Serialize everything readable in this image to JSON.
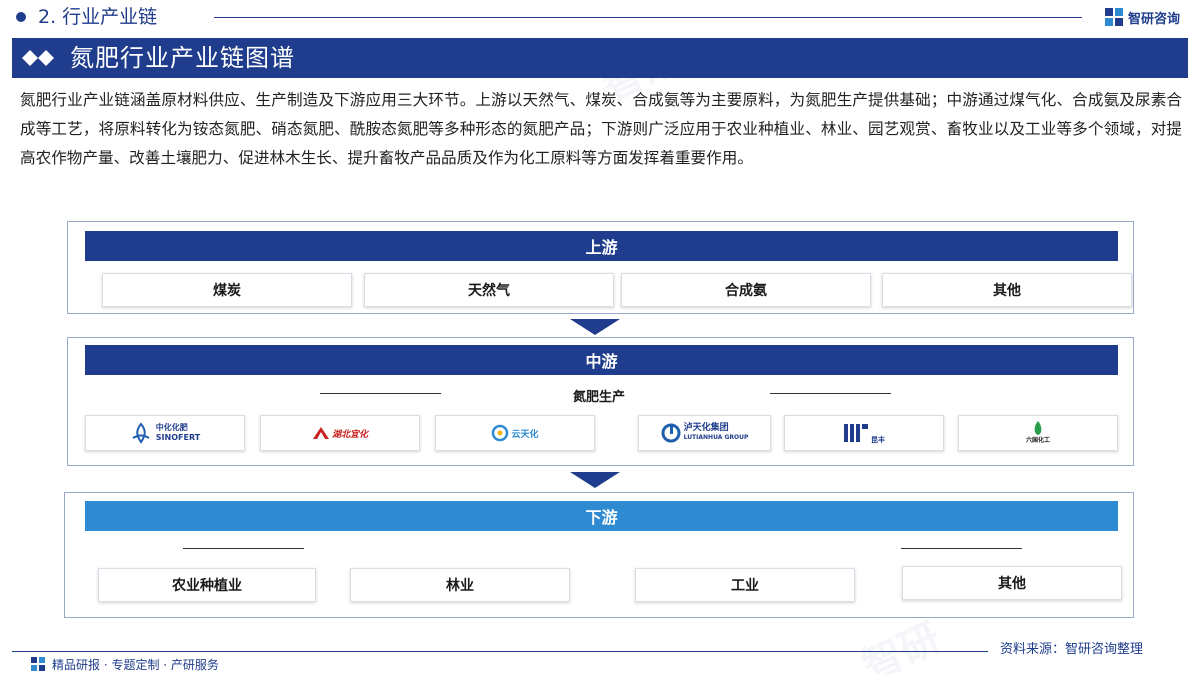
{
  "header": {
    "section_title": "2. 行业产业链",
    "brand_name": "智研咨询",
    "page_title": "氮肥行业产业链图谱"
  },
  "intro": "氮肥行业产业链涵盖原材料供应、生产制造及下游应用三大环节。上游以天然气、煤炭、合成氨等为主要原料，为氮肥生产提供基础；中游通过煤气化、合成氨及尿素合成等工艺，将原料转化为铵态氮肥、硝态氮肥、酰胺态氮肥等多种形态的氮肥产品；下游则广泛应用于农业种植业、林业、园艺观赏、畜牧业以及工业等多个领域，对提高农作物产量、改善土壤肥力、促进林木生长、提升畜牧产品品质及作为化工原料等方面发挥着重要作用。",
  "upstream": {
    "label": "上游",
    "items": [
      "煤炭",
      "天然气",
      "合成氨",
      "其他"
    ]
  },
  "midstream": {
    "label": "中游",
    "sub_label": "氮肥生产",
    "logos": [
      {
        "icon": "sinofert-logo",
        "cn": "中化化肥",
        "en": "SINOFERT"
      },
      {
        "icon": "hubei-yihua-logo",
        "cn": "湖北宜化"
      },
      {
        "icon": "yuntianhua-logo",
        "cn": "云天化"
      },
      {
        "icon": "lutianhua-logo",
        "cn": "泸天化集团",
        "en": "LUTIANHUA GROUP"
      },
      {
        "icon": "huachang-logo",
        "cn": "昆丰"
      },
      {
        "icon": "liuguo-logo",
        "cn": "六国化工"
      }
    ]
  },
  "downstream": {
    "label": "下游",
    "items": [
      "农业种植业",
      "林业",
      "工业",
      "其他"
    ]
  },
  "footer": {
    "source": "资料来源：智研咨询整理",
    "tagline": "精品研报 · 专题定制 · 产研服务"
  },
  "colors": {
    "brand_dark": "#1f3d8c",
    "brand_light": "#2e8bd2"
  }
}
